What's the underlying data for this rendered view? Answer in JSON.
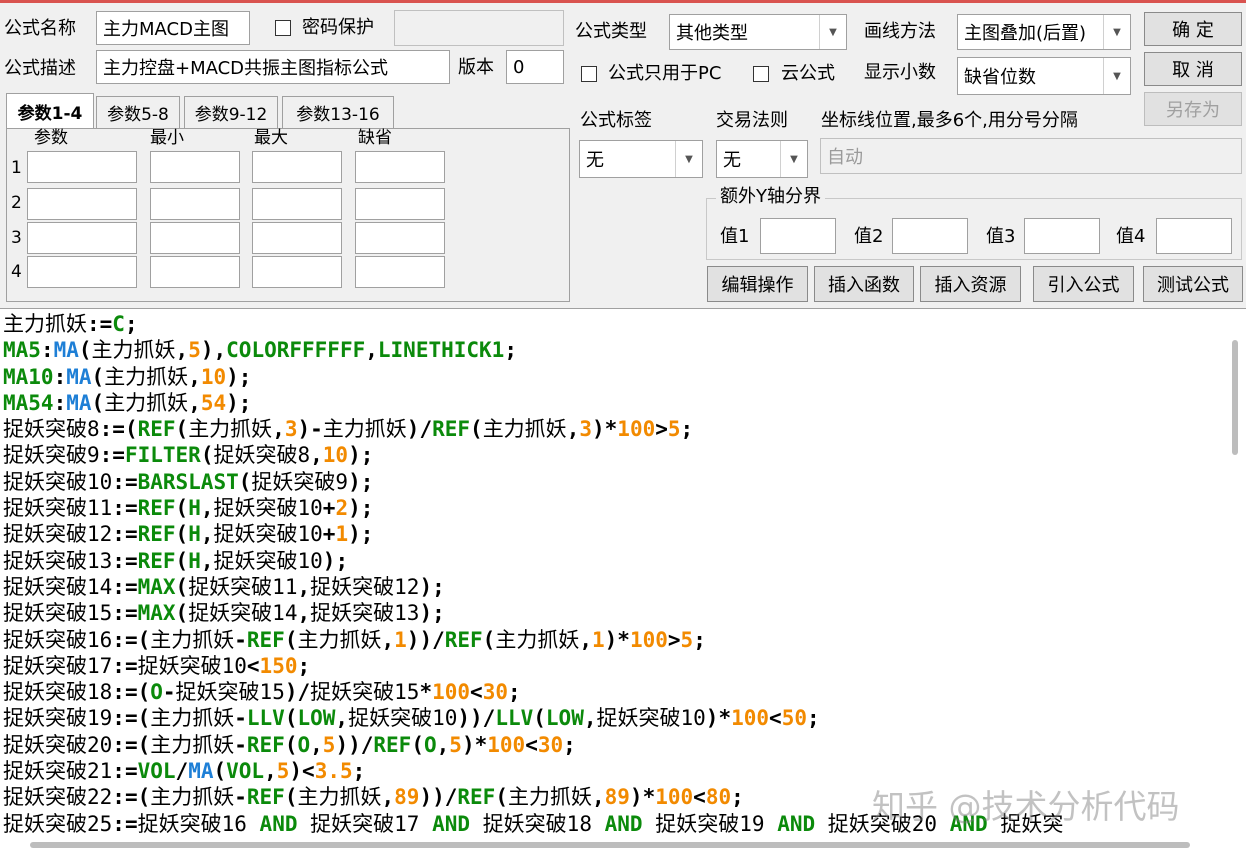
{
  "form": {
    "name_label": "公式名称",
    "name_value": "主力MACD主图",
    "password_label": "密码保护",
    "password_checked": false,
    "password_value": "",
    "desc_label": "公式描述",
    "desc_value": "主力控盘+MACD共振主图指标公式",
    "version_label": "版本",
    "version_value": "0",
    "type_label": "公式类型",
    "type_value": "其他类型",
    "draw_label": "画线方法",
    "draw_value": "主图叠加(后置)",
    "pc_only_label": "公式只用于PC",
    "pc_only_checked": false,
    "cloud_label": "云公式",
    "cloud_checked": false,
    "decimals_label": "显示小数",
    "decimals_value": "缺省位数"
  },
  "buttons": {
    "ok": "确  定",
    "cancel": "取  消",
    "save_as": "另存为"
  },
  "params": {
    "tabs": [
      "参数1-4",
      "参数5-8",
      "参数9-12",
      "参数13-16"
    ],
    "active_tab": 0,
    "headers": [
      "参数",
      "最小",
      "最大",
      "缺省"
    ],
    "rows": [
      {
        "num": "1",
        "values": [
          "",
          "",
          "",
          ""
        ]
      },
      {
        "num": "2",
        "values": [
          "",
          "",
          "",
          ""
        ]
      },
      {
        "num": "3",
        "values": [
          "",
          "",
          "",
          ""
        ]
      },
      {
        "num": "4",
        "values": [
          "",
          "",
          "",
          ""
        ]
      }
    ]
  },
  "meta": {
    "tag_label": "公式标签",
    "tag_value": "无",
    "rule_label": "交易法则",
    "rule_value": "无",
    "axis_label": "坐标线位置,最多6个,用分号分隔",
    "axis_value": "自动",
    "extra_y_label": "额外Y轴分界",
    "values": [
      {
        "label": "值1",
        "value": ""
      },
      {
        "label": "值2",
        "value": ""
      },
      {
        "label": "值3",
        "value": ""
      },
      {
        "label": "值4",
        "value": ""
      }
    ]
  },
  "actions": [
    "编辑操作",
    "插入函数",
    "插入资源",
    "引入公式",
    "测试公式"
  ],
  "code": [
    "主力抓妖:=C;",
    "MA5:MA(主力抓妖,5),COLORFFFFFF,LINETHICK1;",
    "MA10:MA(主力抓妖,10);",
    "MA54:MA(主力抓妖,54);",
    "捉妖突破8:=(REF(主力抓妖,3)-主力抓妖)/REF(主力抓妖,3)*100>5;",
    "捉妖突破9:=FILTER(捉妖突破8,10);",
    "捉妖突破10:=BARSLAST(捉妖突破9);",
    "捉妖突破11:=REF(H,捉妖突破10+2);",
    "捉妖突破12:=REF(H,捉妖突破10+1);",
    "捉妖突破13:=REF(H,捉妖突破10);",
    "捉妖突破14:=MAX(捉妖突破11,捉妖突破12);",
    "捉妖突破15:=MAX(捉妖突破14,捉妖突破13);",
    "捉妖突破16:=(主力抓妖-REF(主力抓妖,1))/REF(主力抓妖,1)*100>5;",
    "捉妖突破17:=捉妖突破10<150;",
    "捉妖突破18:=(O-捉妖突破15)/捉妖突破15*100<30;",
    "捉妖突破19:=(主力抓妖-LLV(LOW,捉妖突破10))/LLV(LOW,捉妖突破10)*100<50;",
    "捉妖突破20:=(主力抓妖-REF(O,5))/REF(O,5)*100<30;",
    "捉妖突破21:=VOL/MA(VOL,5)<3.5;",
    "捉妖突破22:=(主力抓妖-REF(主力抓妖,89))/REF(主力抓妖,89)*100<80;",
    "捉妖突破25:=捉妖突破16 AND 捉妖突破17 AND 捉妖突破18 AND 捉妖突破19 AND 捉妖突破20 AND 捉妖突"
  ],
  "watermark": "知乎 @技术分析代码"
}
